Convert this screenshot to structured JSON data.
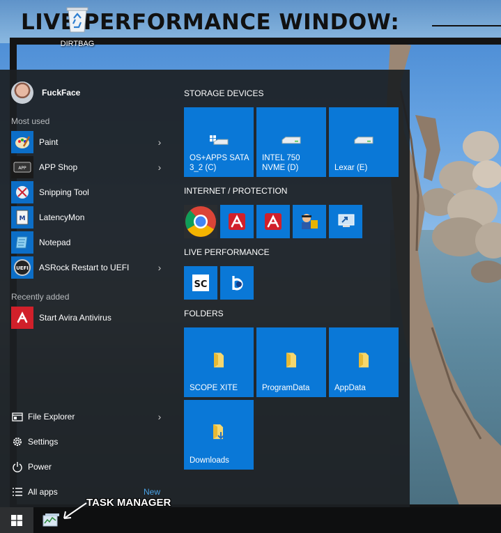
{
  "desktop": {
    "banner_text": "LIVE PERFORMANCE WINDOW:",
    "recycle_bin_label": "DIRTBAG"
  },
  "user": {
    "name": "FuckFace"
  },
  "most_used": {
    "label": "Most used",
    "items": [
      {
        "label": "Paint",
        "icon": "paint-icon",
        "has_submenu": true
      },
      {
        "label": "APP Shop",
        "icon": "app-shop-icon",
        "has_submenu": true
      },
      {
        "label": "Snipping Tool",
        "icon": "snipping-tool-icon",
        "has_submenu": false
      },
      {
        "label": "LatencyMon",
        "icon": "latencymon-icon",
        "has_submenu": false
      },
      {
        "label": "Notepad",
        "icon": "notepad-icon",
        "has_submenu": false
      },
      {
        "label": "ASRock Restart to UEFI",
        "icon": "uefi-icon",
        "has_submenu": true
      }
    ]
  },
  "recently_added": {
    "label": "Recently added",
    "items": [
      {
        "label": "Start Avira Antivirus",
        "icon": "avira-icon"
      }
    ]
  },
  "bottom": {
    "file_explorer": "File Explorer",
    "settings": "Settings",
    "power": "Power",
    "all_apps": "All apps",
    "new_badge": "New"
  },
  "groups": {
    "storage": {
      "title": "STORAGE DEVICES",
      "tiles": [
        {
          "label": "OS+APPS SATA 3_2 (C)",
          "icon": "windows-drive-icon"
        },
        {
          "label": "INTEL 750 NVME (D)",
          "icon": "drive-icon"
        },
        {
          "label": "Lexar (E)",
          "icon": "drive-icon"
        }
      ]
    },
    "internet": {
      "title": "INTERNET / PROTECTION",
      "tiles": [
        {
          "icon": "chrome-icon"
        },
        {
          "icon": "avira-icon"
        },
        {
          "icon": "avira-icon"
        },
        {
          "icon": "security-tool-icon"
        },
        {
          "icon": "remote-desktop-icon"
        }
      ]
    },
    "live": {
      "title": "LIVE PERFORMANCE",
      "tiles": [
        {
          "icon": "sc-icon",
          "text": "SC"
        },
        {
          "icon": "audio-app-icon"
        }
      ]
    },
    "folders": {
      "title": "FOLDERS",
      "tiles": [
        {
          "label": "SCOPE XITE",
          "icon": "folder-icon"
        },
        {
          "label": "ProgramData",
          "icon": "folder-icon"
        },
        {
          "label": "AppData",
          "icon": "folder-icon"
        },
        {
          "label": "Downloads",
          "icon": "downloads-folder-icon"
        }
      ]
    }
  },
  "taskbar": {
    "annotation": "TASK MANAGER"
  },
  "colors": {
    "tile_blue": "#0a78d7",
    "menu_bg": "#1c1f22",
    "accent_text": "#4aa3e8"
  }
}
